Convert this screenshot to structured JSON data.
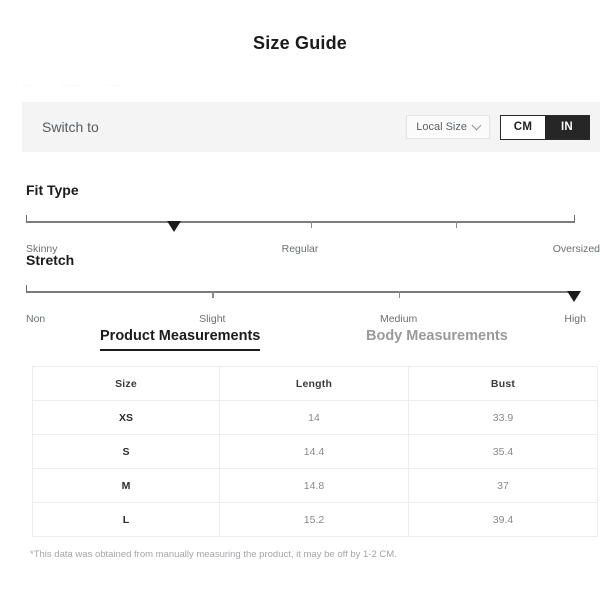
{
  "page": {
    "title": "Size Guide",
    "ghost_fragments": [
      "····",
      "······",
      "·····"
    ]
  },
  "switch_bar": {
    "label": "Switch to",
    "region_select": {
      "value": "Local Size",
      "icon": "chevron-down-icon"
    },
    "units": [
      {
        "label": "CM",
        "selected": false
      },
      {
        "label": "IN",
        "selected": true
      }
    ]
  },
  "scales": [
    {
      "heading": "Fit Type",
      "labels": [
        "Skinny",
        "Regular",
        "Oversized"
      ],
      "marker_percent": 27
    },
    {
      "heading": "Stretch",
      "labels": [
        "Non",
        "Slight",
        "Medium",
        "High"
      ],
      "marker_percent": 100
    }
  ],
  "tabs": [
    {
      "label": "Product Measurements",
      "active": true
    },
    {
      "label": "Body Measurements",
      "active": false
    }
  ],
  "table": {
    "headers": [
      "Size",
      "Length",
      "Bust"
    ],
    "rows": [
      {
        "size": "XS",
        "length": "14",
        "bust": "33.9"
      },
      {
        "size": "S",
        "length": "14.4",
        "bust": "35.4"
      },
      {
        "size": "M",
        "length": "14.8",
        "bust": "37"
      },
      {
        "size": "L",
        "length": "15.2",
        "bust": "39.4"
      }
    ]
  },
  "footnote": "*This data was obtained from manually measuring the product, it may be off by 1-2 CM.",
  "colors": {
    "bar_background": "#f4f4f4",
    "unit_selected_bg": "#262626",
    "text_primary": "#1b1b1b",
    "text_muted": "#86898c",
    "table_border": "#ededed"
  }
}
